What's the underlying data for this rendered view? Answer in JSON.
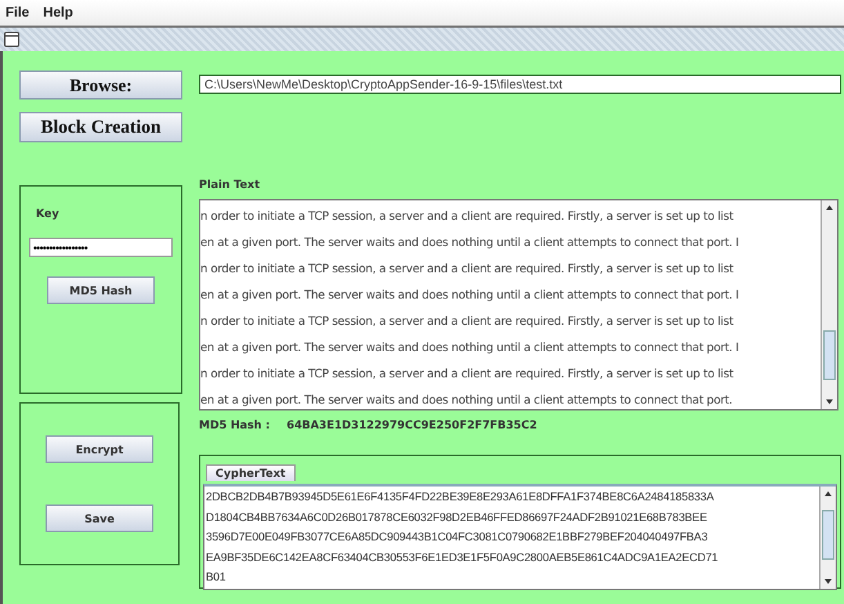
{
  "menu": [
    "File",
    "Help"
  ],
  "browse_button": "Browse:",
  "block_creation_button": "Block Creation",
  "file_path": "C:\\Users\\NewMe\\Desktop\\CryptoAppSender-16-9-15\\files\\test.txt",
  "key_panel": {
    "label": "Key",
    "value": "•••••••••••••••••",
    "button": "MD5 Hash"
  },
  "plain_text": {
    "label": "Plain Text",
    "lines": [
      "n order to initiate a TCP session, a server and a client are required. Firstly, a server is set up to list",
      "en at a given port. The server waits and does nothing until a client attempts to connect that port. I",
      "n order to initiate a TCP session, a server and a client are required. Firstly, a server is set up to list",
      "en at a given port. The server waits and does nothing until a client attempts to connect that port. I",
      "n order to initiate a TCP session, a server and a client are required. Firstly, a server is set up to list",
      "en at a given port. The server waits and does nothing until a client attempts to connect that port. I",
      "n order to initiate a TCP session, a server and a client are required. Firstly, a server is set up to list",
      "en at a given port. The server waits and does nothing until a client attempts to connect that port."
    ]
  },
  "md5": {
    "label": "MD5 Hash :",
    "value": "64BA3E1D3122979CC9E250F2F7FB35C2"
  },
  "action_buttons": [
    "Encrypt",
    "Save"
  ],
  "cypher": {
    "tab": "CypherText",
    "lines": [
      "2DBCB2DB4B7B93945D5E61E6F4135F4FD22BE39E8E293A61E8DFFA1F374BE8C6A2484185833A",
      "D1804CB4BB7634A6C0D26B017878CE6032F98D2EB46FFED86697F24ADF2B91021E68B783BEE",
      "3596D7E00E049FB3077CE6A85DC909443B1C04FC3081C0790682E1BBF279BEF204040497FBA3",
      "EA9BF35DE6C142EA8CF63404CB30553F6E1ED3E1F5F0A9C2800AEB5E861C4ADC9A1EA2ECD71",
      "B01"
    ]
  }
}
